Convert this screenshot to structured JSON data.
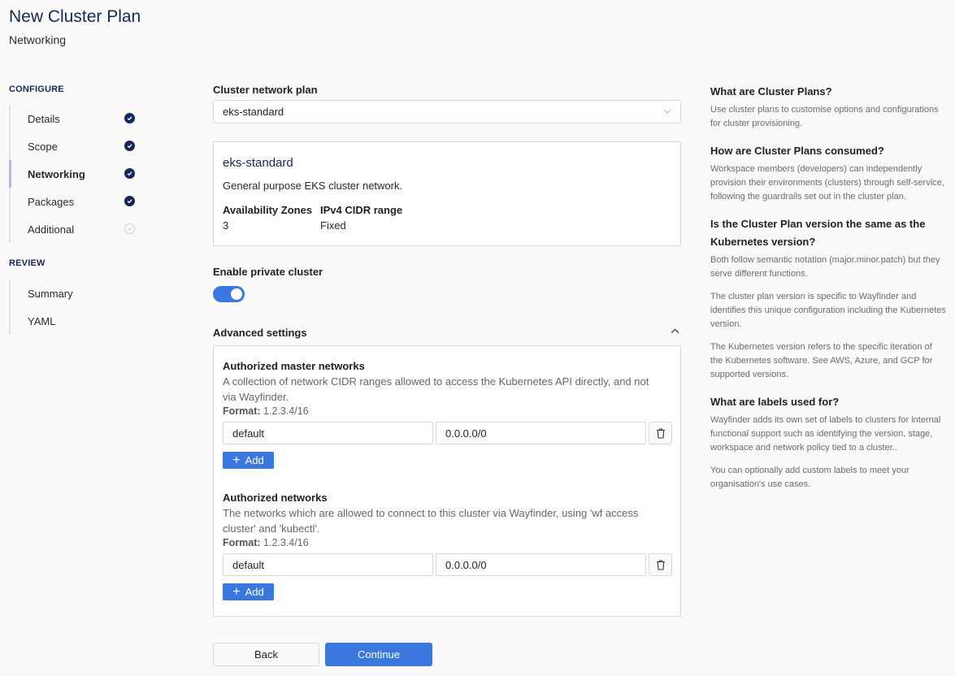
{
  "header": {
    "title": "New Cluster Plan",
    "subtitle": "Networking"
  },
  "sidebar": {
    "sections": [
      {
        "title": "CONFIGURE",
        "steps": [
          {
            "label": "Details",
            "status": "complete"
          },
          {
            "label": "Scope",
            "status": "complete"
          },
          {
            "label": "Networking",
            "status": "complete",
            "active": true
          },
          {
            "label": "Packages",
            "status": "complete"
          },
          {
            "label": "Additional",
            "status": "pending"
          }
        ]
      },
      {
        "title": "REVIEW",
        "steps": [
          {
            "label": "Summary"
          },
          {
            "label": "YAML"
          }
        ]
      }
    ]
  },
  "main": {
    "network_plan": {
      "label": "Cluster network plan",
      "selected": "eks-standard"
    },
    "plan_card": {
      "name": "eks-standard",
      "description": "General purpose EKS cluster network.",
      "attributes": [
        {
          "key": "Availability Zones",
          "value": "3"
        },
        {
          "key": "IPv4 CIDR range",
          "value": "Fixed"
        }
      ]
    },
    "private_cluster": {
      "label": "Enable private cluster",
      "enabled": true
    },
    "advanced": {
      "label": "Advanced settings",
      "expanded": true,
      "blocks": [
        {
          "title": "Authorized master networks",
          "description": "A collection of network CIDR ranges allowed to access the Kubernetes API directly, and not via Wayfinder.",
          "format_label": "Format:",
          "format_value": "1.2.3.4/16",
          "rows": [
            {
              "name": "default",
              "cidr": "0.0.0.0/0"
            }
          ],
          "add_label": "Add"
        },
        {
          "title": "Authorized networks",
          "description": "The networks which are allowed to connect to this cluster via Wayfinder, using 'wf access cluster' and 'kubectl'.",
          "format_label": "Format:",
          "format_value": "1.2.3.4/16",
          "rows": [
            {
              "name": "default",
              "cidr": "0.0.0.0/0"
            }
          ],
          "add_label": "Add"
        }
      ]
    },
    "actions": {
      "back": "Back",
      "continue": "Continue"
    }
  },
  "help": [
    {
      "question": "What are Cluster Plans?",
      "answers": [
        "Use cluster plans to customise options and configurations for cluster provisioning."
      ]
    },
    {
      "question": "How are Cluster Plans consumed?",
      "answers": [
        "Workspace members (developers) can independently provision their environments (clusters) through self-service, following the guardrails set out in the cluster plan."
      ]
    },
    {
      "question": "Is the Cluster Plan version the same as the Kubernetes version?",
      "answers": [
        "Both follow semantic notation (major.minor.patch) but they serve different functions.",
        "The cluster plan version is specific to Wayfinder and identifies this unique configuration including the Kubernetes version.",
        "The Kubernetes version refers to the specific iteration of the Kubernetes software. See AWS, Azure, and GCP for supported versions."
      ]
    },
    {
      "question": "What are labels used for?",
      "answers": [
        "Wayfinder adds its own set of labels to clusters for internal functional support such as identifying the version, stage, workspace and network policy tied to a cluster..",
        "You can optionally add custom labels to meet your organisation's use cases."
      ]
    }
  ],
  "colors": {
    "brand_navy": "#16285a",
    "primary_blue": "#3a78e0",
    "active_step_bar": "#b9b4f0"
  }
}
